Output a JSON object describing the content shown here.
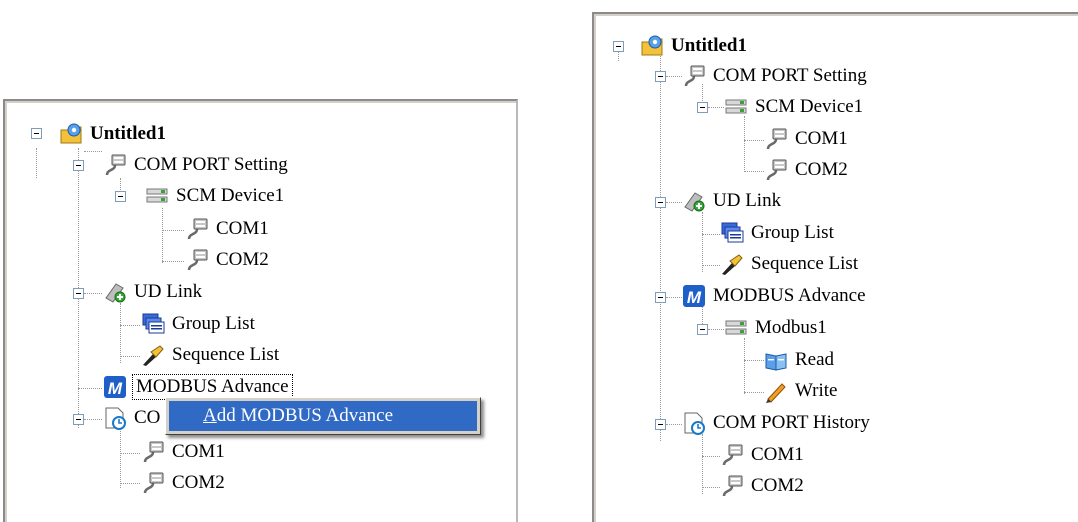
{
  "left_tree": {
    "root": "Untitled1",
    "com_port_setting": "COM PORT Setting",
    "scm_device": "SCM Device1",
    "com1": "COM1",
    "com2": "COM2",
    "ud_link": "UD Link",
    "group_list": "Group List",
    "sequence_list": "Sequence List",
    "modbus_advance": "MODBUS Advance",
    "com_port_history_partial": "CO",
    "hist_com1": "COM1",
    "hist_com2": "COM2"
  },
  "context_menu": {
    "add_modbus_advance_accel": "A",
    "add_modbus_advance_rest": "dd MODBUS Advance"
  },
  "right_tree": {
    "root": "Untitled1",
    "com_port_setting": "COM PORT Setting",
    "scm_device": "SCM Device1",
    "com1": "COM1",
    "com2": "COM2",
    "ud_link": "UD Link",
    "group_list": "Group List",
    "sequence_list": "Sequence List",
    "modbus_advance": "MODBUS Advance",
    "modbus1": "Modbus1",
    "read": "Read",
    "write": "Write",
    "com_port_history": "COM PORT History",
    "hist_com1": "COM1",
    "hist_com2": "COM2"
  },
  "colors": {
    "selection": "#316ac5",
    "menu_bg": "#d4d0c8",
    "tree_line": "#999999",
    "modbus_badge": "#1e5fc8"
  }
}
